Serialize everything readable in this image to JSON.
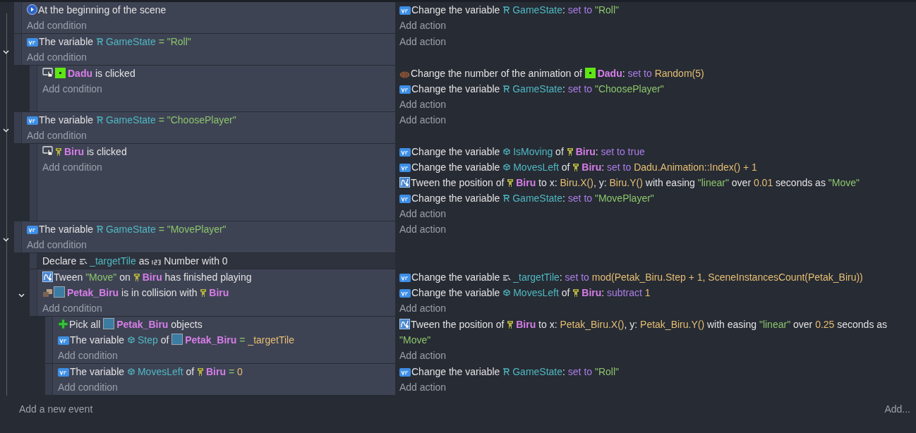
{
  "events": [
    {
      "conditions": [
        {
          "kind": "start",
          "parts": [
            {
              "kind": "text",
              "text": "At the beginning of the scene"
            }
          ]
        }
      ],
      "add_condition": "Add condition",
      "actions": [
        {
          "kind": "variable",
          "parts": [
            {
              "kind": "text",
              "text": "Change the variable "
            },
            {
              "kind": "scenevar",
              "text": "GameState"
            },
            {
              "kind": "text",
              "text": ": "
            },
            {
              "kind": "op",
              "text": "set to "
            },
            {
              "kind": "string",
              "text": "\"Roll\""
            }
          ]
        }
      ],
      "add_action": "Add action"
    },
    {
      "expanded": true,
      "conditions": [
        {
          "kind": "variable",
          "parts": [
            {
              "kind": "text",
              "text": "The variable "
            },
            {
              "kind": "scenevar",
              "text": "GameState"
            },
            {
              "kind": "eq",
              "text": " = "
            },
            {
              "kind": "string",
              "text": "\"Roll\""
            }
          ]
        }
      ],
      "add_condition": "Add condition",
      "add_action": "Add action",
      "children": [
        {
          "conditions": [
            {
              "kind": "cursor",
              "parts": [
                {
                  "kind": "block",
                  "text": "Dadu"
                },
                {
                  "kind": "text",
                  "text": " is clicked"
                }
              ]
            }
          ],
          "add_condition": "Add condition",
          "actions": [
            {
              "kind": "animation",
              "parts": [
                {
                  "kind": "text",
                  "text": "Change the number of the animation of "
                },
                {
                  "kind": "block",
                  "text": "Dadu"
                },
                {
                  "kind": "text",
                  "text": ": "
                },
                {
                  "kind": "op",
                  "text": "set to "
                },
                {
                  "kind": "expr",
                  "text": "Random(5)"
                }
              ]
            },
            {
              "kind": "variable",
              "parts": [
                {
                  "kind": "text",
                  "text": "Change the variable "
                },
                {
                  "kind": "scenevar",
                  "text": "GameState"
                },
                {
                  "kind": "text",
                  "text": ": "
                },
                {
                  "kind": "op",
                  "text": "set to "
                },
                {
                  "kind": "string",
                  "text": "\"ChoosePlayer\""
                }
              ]
            }
          ],
          "add_action": "Add action"
        }
      ]
    },
    {
      "expanded": true,
      "conditions": [
        {
          "kind": "variable",
          "parts": [
            {
              "kind": "text",
              "text": "The variable "
            },
            {
              "kind": "scenevar",
              "text": "GameState"
            },
            {
              "kind": "eq",
              "text": " = "
            },
            {
              "kind": "string",
              "text": "\"ChoosePlayer\""
            }
          ]
        }
      ],
      "add_condition": "Add condition",
      "add_action": "Add action",
      "children": [
        {
          "conditions": [
            {
              "kind": "cursor",
              "parts": [
                {
                  "kind": "figure",
                  "text": "Biru"
                },
                {
                  "kind": "text",
                  "text": " is clicked"
                }
              ]
            }
          ],
          "add_condition": "Add condition",
          "actions": [
            {
              "kind": "variable",
              "parts": [
                {
                  "kind": "text",
                  "text": "Change the variable "
                },
                {
                  "kind": "objvar",
                  "text": "IsMoving"
                },
                {
                  "kind": "text",
                  "text": " of "
                },
                {
                  "kind": "figure",
                  "text": "Biru"
                },
                {
                  "kind": "text",
                  "text": ": "
                },
                {
                  "kind": "op",
                  "text": "set to true"
                }
              ]
            },
            {
              "kind": "variable",
              "parts": [
                {
                  "kind": "text",
                  "text": "Change the variable "
                },
                {
                  "kind": "objvar",
                  "text": "MovesLeft"
                },
                {
                  "kind": "text",
                  "text": " of "
                },
                {
                  "kind": "figure",
                  "text": "Biru"
                },
                {
                  "kind": "text",
                  "text": ": "
                },
                {
                  "kind": "op",
                  "text": "set to "
                },
                {
                  "kind": "expr",
                  "text": "Dadu.Animation::Index() + 1"
                }
              ]
            },
            {
              "kind": "tween",
              "parts": [
                {
                  "kind": "text",
                  "text": "Tween the position of "
                },
                {
                  "kind": "figure",
                  "text": "Biru"
                },
                {
                  "kind": "text",
                  "text": " to x: "
                },
                {
                  "kind": "expr",
                  "text": "Biru.X()"
                },
                {
                  "kind": "text",
                  "text": ", y: "
                },
                {
                  "kind": "expr",
                  "text": "Biru.Y()"
                },
                {
                  "kind": "text",
                  "text": " with easing "
                },
                {
                  "kind": "string",
                  "text": "\"linear\""
                },
                {
                  "kind": "text",
                  "text": " over "
                },
                {
                  "kind": "expr",
                  "text": "0.01"
                },
                {
                  "kind": "text",
                  "text": " seconds as "
                },
                {
                  "kind": "string",
                  "text": "\"Move\""
                }
              ]
            },
            {
              "kind": "variable",
              "parts": [
                {
                  "kind": "text",
                  "text": "Change the variable "
                },
                {
                  "kind": "scenevar",
                  "text": "GameState"
                },
                {
                  "kind": "text",
                  "text": ": "
                },
                {
                  "kind": "op",
                  "text": "set to "
                },
                {
                  "kind": "string",
                  "text": "\"MovePlayer\""
                }
              ]
            }
          ],
          "add_action": "Add action"
        }
      ]
    },
    {
      "expanded": true,
      "conditions": [
        {
          "kind": "variable",
          "parts": [
            {
              "kind": "text",
              "text": "The variable "
            },
            {
              "kind": "scenevar",
              "text": "GameState"
            },
            {
              "kind": "eq",
              "text": " = "
            },
            {
              "kind": "string",
              "text": "\"MovePlayer\""
            }
          ]
        }
      ],
      "add_condition": "Add condition",
      "add_action": "Add action",
      "local_variables": [
        {
          "parts": [
            {
              "kind": "text",
              "text": "Declare "
            },
            {
              "kind": "localvar",
              "text": "_targetTile"
            },
            {
              "kind": "text",
              "text": " as "
            },
            {
              "kind": "numtype",
              "text": "Number"
            },
            {
              "kind": "text",
              "text": " with 0"
            }
          ]
        }
      ],
      "children": [
        {
          "expanded": true,
          "conditions": [
            {
              "kind": "tween",
              "parts": [
                {
                  "kind": "text",
                  "text": "Tween "
                },
                {
                  "kind": "string",
                  "text": "\"Move\""
                },
                {
                  "kind": "text",
                  "text": " on "
                },
                {
                  "kind": "figure",
                  "text": "Biru"
                },
                {
                  "kind": "text",
                  "text": " has finished playing"
                }
              ]
            },
            {
              "kind": "collision",
              "parts": [
                {
                  "kind": "tile",
                  "text": "Petak_Biru"
                },
                {
                  "kind": "text",
                  "text": " is in collision with "
                },
                {
                  "kind": "figure",
                  "text": "Biru"
                }
              ]
            }
          ],
          "add_condition": "Add condition",
          "actions": [
            {
              "kind": "variable",
              "parts": [
                {
                  "kind": "text",
                  "text": "Change the variable "
                },
                {
                  "kind": "localvar",
                  "text": "_targetTile"
                },
                {
                  "kind": "text",
                  "text": ": "
                },
                {
                  "kind": "op",
                  "text": "set to "
                },
                {
                  "kind": "expr",
                  "text": "mod(Petak_Biru.Step + 1, SceneInstancesCount(Petak_Biru))"
                }
              ]
            },
            {
              "kind": "variable",
              "parts": [
                {
                  "kind": "text",
                  "text": "Change the variable "
                },
                {
                  "kind": "objvar",
                  "text": "MovesLeft"
                },
                {
                  "kind": "text",
                  "text": " of "
                },
                {
                  "kind": "figure",
                  "text": "Biru"
                },
                {
                  "kind": "text",
                  "text": ": "
                },
                {
                  "kind": "op",
                  "text": "subtract "
                },
                {
                  "kind": "expr",
                  "text": "1"
                }
              ]
            }
          ],
          "add_action": "Add action",
          "children": [
            {
              "conditions": [
                {
                  "kind": "pick",
                  "parts": [
                    {
                      "kind": "text",
                      "text": "Pick all "
                    },
                    {
                      "kind": "tile",
                      "text": "Petak_Biru"
                    },
                    {
                      "kind": "text",
                      "text": " objects"
                    }
                  ]
                },
                {
                  "kind": "variable",
                  "parts": [
                    {
                      "kind": "text",
                      "text": "The variable "
                    },
                    {
                      "kind": "objvar",
                      "text": "Step"
                    },
                    {
                      "kind": "text",
                      "text": " of "
                    },
                    {
                      "kind": "tile",
                      "text": "Petak_Biru"
                    },
                    {
                      "kind": "eq",
                      "text": " = "
                    },
                    {
                      "kind": "expr",
                      "text": "_targetTile"
                    }
                  ]
                }
              ],
              "add_condition": "Add condition",
              "actions": [
                {
                  "kind": "tween",
                  "parts": [
                    {
                      "kind": "text",
                      "text": "Tween the position of "
                    },
                    {
                      "kind": "figure",
                      "text": "Biru"
                    },
                    {
                      "kind": "text",
                      "text": " to x: "
                    },
                    {
                      "kind": "expr",
                      "text": "Petak_Biru.X()"
                    },
                    {
                      "kind": "text",
                      "text": ", y: "
                    },
                    {
                      "kind": "expr",
                      "text": "Petak_Biru.Y()"
                    },
                    {
                      "kind": "text",
                      "text": " with easing "
                    },
                    {
                      "kind": "string",
                      "text": "\"linear\""
                    },
                    {
                      "kind": "text",
                      "text": " over "
                    },
                    {
                      "kind": "expr",
                      "text": "0.25"
                    },
                    {
                      "kind": "text",
                      "text": " seconds as "
                    },
                    {
                      "kind": "string",
                      "text": "\"Move\""
                    }
                  ]
                }
              ],
              "add_action": "Add action"
            },
            {
              "conditions": [
                {
                  "kind": "variable",
                  "parts": [
                    {
                      "kind": "text",
                      "text": "The variable "
                    },
                    {
                      "kind": "objvar",
                      "text": "MovesLeft"
                    },
                    {
                      "kind": "text",
                      "text": " of "
                    },
                    {
                      "kind": "figure",
                      "text": "Biru"
                    },
                    {
                      "kind": "eq",
                      "text": " = "
                    },
                    {
                      "kind": "expr",
                      "text": "0"
                    }
                  ]
                }
              ],
              "add_condition": "Add condition",
              "actions": [
                {
                  "kind": "variable",
                  "parts": [
                    {
                      "kind": "text",
                      "text": "Change the variable "
                    },
                    {
                      "kind": "scenevar",
                      "text": "GameState"
                    },
                    {
                      "kind": "text",
                      "text": ": "
                    },
                    {
                      "kind": "op",
                      "text": "set to "
                    },
                    {
                      "kind": "string",
                      "text": "\"Roll\""
                    }
                  ]
                }
              ],
              "add_action": "Add action"
            }
          ]
        }
      ]
    }
  ],
  "footer": {
    "add_event": "Add a new event",
    "add_menu": "Add..."
  }
}
